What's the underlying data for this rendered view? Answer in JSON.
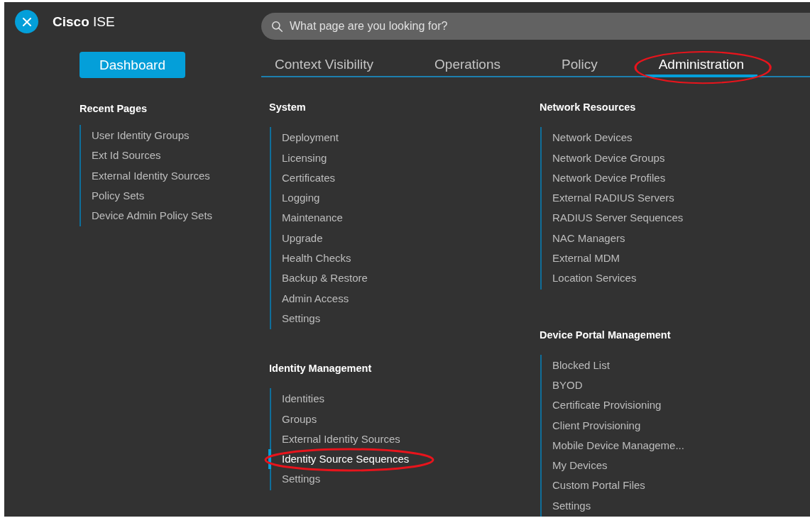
{
  "brand": {
    "strong": "Cisco",
    "rest": "ISE"
  },
  "search": {
    "placeholder": "What page are you looking for?"
  },
  "dashboard_button": "Dashboard",
  "recent_pages": {
    "title": "Recent Pages",
    "items": [
      "User Identity Groups",
      "Ext Id Sources",
      "External Identity Sources",
      "Policy Sets",
      "Device Admin Policy Sets"
    ]
  },
  "tabs": [
    {
      "label": "Context Visibility",
      "selected": false,
      "circled": false
    },
    {
      "label": "Operations",
      "selected": false,
      "circled": false
    },
    {
      "label": "Policy",
      "selected": false,
      "circled": false
    },
    {
      "label": "Administration",
      "selected": true,
      "circled": true
    }
  ],
  "columns": [
    {
      "sections": [
        {
          "title": "System",
          "items": [
            {
              "label": "Deployment",
              "selected": false,
              "circled": false
            },
            {
              "label": "Licensing",
              "selected": false,
              "circled": false
            },
            {
              "label": "Certificates",
              "selected": false,
              "circled": false
            },
            {
              "label": "Logging",
              "selected": false,
              "circled": false
            },
            {
              "label": "Maintenance",
              "selected": false,
              "circled": false
            },
            {
              "label": "Upgrade",
              "selected": false,
              "circled": false
            },
            {
              "label": "Health Checks",
              "selected": false,
              "circled": false
            },
            {
              "label": "Backup & Restore",
              "selected": false,
              "circled": false
            },
            {
              "label": "Admin Access",
              "selected": false,
              "circled": false
            },
            {
              "label": "Settings",
              "selected": false,
              "circled": false
            }
          ]
        },
        {
          "title": "Identity Management",
          "items": [
            {
              "label": "Identities",
              "selected": false,
              "circled": false
            },
            {
              "label": "Groups",
              "selected": false,
              "circled": false
            },
            {
              "label": "External Identity Sources",
              "selected": false,
              "circled": false
            },
            {
              "label": "Identity Source Sequences",
              "selected": true,
              "circled": true
            },
            {
              "label": "Settings",
              "selected": false,
              "circled": false
            }
          ]
        }
      ]
    },
    {
      "sections": [
        {
          "title": "Network Resources",
          "items": [
            {
              "label": "Network Devices",
              "selected": false,
              "circled": false
            },
            {
              "label": "Network Device Groups",
              "selected": false,
              "circled": false
            },
            {
              "label": "Network Device Profiles",
              "selected": false,
              "circled": false
            },
            {
              "label": "External RADIUS Servers",
              "selected": false,
              "circled": false
            },
            {
              "label": "RADIUS Server Sequences",
              "selected": false,
              "circled": false
            },
            {
              "label": "NAC Managers",
              "selected": false,
              "circled": false
            },
            {
              "label": "External MDM",
              "selected": false,
              "circled": false
            },
            {
              "label": "Location Services",
              "selected": false,
              "circled": false
            }
          ]
        },
        {
          "title": "Device Portal Management",
          "items": [
            {
              "label": "Blocked List",
              "selected": false,
              "circled": false
            },
            {
              "label": "BYOD",
              "selected": false,
              "circled": false
            },
            {
              "label": "Certificate Provisioning",
              "selected": false,
              "circled": false
            },
            {
              "label": "Client Provisioning",
              "selected": false,
              "circled": false
            },
            {
              "label": "Mobile Device Manageme...",
              "selected": false,
              "circled": false
            },
            {
              "label": "My Devices",
              "selected": false,
              "circled": false
            },
            {
              "label": "Custom Portal Files",
              "selected": false,
              "circled": false
            },
            {
              "label": "Settings",
              "selected": false,
              "circled": false
            }
          ]
        }
      ]
    }
  ]
}
